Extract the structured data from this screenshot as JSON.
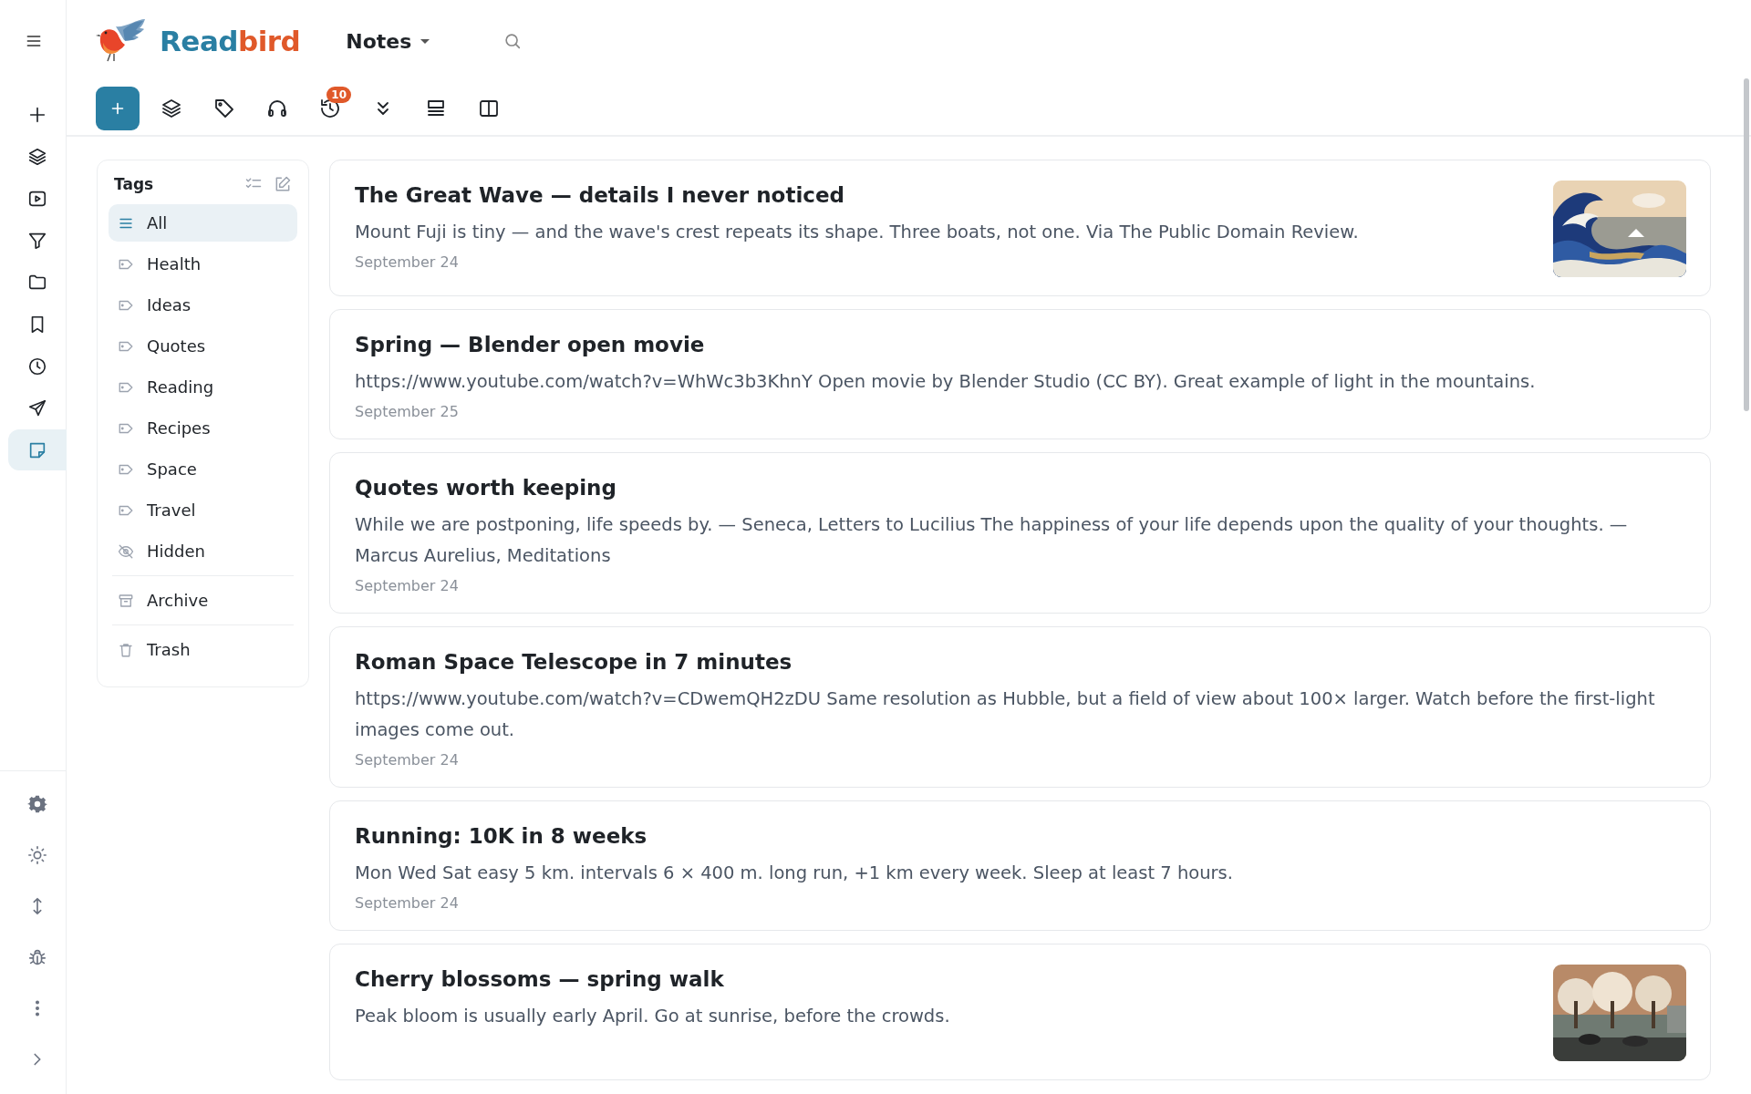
{
  "rail": {
    "top": [
      {
        "selected": false
      },
      {
        "selected": false
      },
      {
        "selected": false
      },
      {
        "selected": false
      },
      {
        "selected": false
      },
      {
        "selected": false
      },
      {
        "selected": false
      },
      {
        "selected": false
      },
      {
        "selected": true
      }
    ],
    "bottom": [
      {
        "selected": false
      },
      {
        "selected": false
      },
      {
        "selected": false
      },
      {
        "selected": false
      },
      {
        "selected": false
      },
      {
        "selected": false
      }
    ]
  },
  "header": {
    "brand": {
      "parts": [
        "Read",
        "bird"
      ]
    },
    "view_menu": {
      "label": "Notes"
    },
    "toolbar": {
      "history_badge": "10"
    }
  },
  "tags": {
    "title": "Tags",
    "items": [
      {
        "kind": "all",
        "label": "All",
        "selected": true
      },
      {
        "kind": "tag",
        "label": "Health",
        "selected": false
      },
      {
        "kind": "tag",
        "label": "Ideas",
        "selected": false
      },
      {
        "kind": "tag",
        "label": "Quotes",
        "selected": false
      },
      {
        "kind": "tag",
        "label": "Reading",
        "selected": false
      },
      {
        "kind": "tag",
        "label": "Recipes",
        "selected": false
      },
      {
        "kind": "tag",
        "label": "Space",
        "selected": false
      },
      {
        "kind": "tag",
        "label": "Travel",
        "selected": false
      },
      {
        "kind": "hidden",
        "label": "Hidden",
        "selected": false
      },
      {
        "kind": "archive",
        "label": "Archive",
        "selected": false
      },
      {
        "kind": "trash",
        "label": "Trash",
        "selected": false
      }
    ]
  },
  "notes": [
    {
      "title": "The Great Wave — details I never noticed",
      "body": "Mount Fuji is tiny — and the wave's crest repeats its shape. Three boats, not one.  Via The Public Domain Review.",
      "date": "September 24",
      "thumbnail": true
    },
    {
      "title": "Spring — Blender open movie",
      "body": "https://www.youtube.com/watch?v=WhWc3b3KhnY Open movie by Blender Studio (CC BY). Great example of light in the mountains.",
      "date": "September 25",
      "thumbnail": false
    },
    {
      "title": "Quotes worth keeping",
      "body": "While we are postponing, life speeds by. — Seneca, Letters to Lucilius The happiness of your life depends upon the quality of your thoughts. — Marcus Aurelius, Meditations",
      "date": "September 24",
      "thumbnail": false
    },
    {
      "title": "Roman Space Telescope in 7 minutes",
      "body": "https://www.youtube.com/watch?v=CDwemQH2zDU Same resolution as Hubble, but a field of view about 100× larger. Watch before the first-light images come out.",
      "date": "September 24",
      "thumbnail": false
    },
    {
      "title": "Running: 10K in 8 weeks",
      "body": "Mon  Wed  Sat  easy 5 km. intervals 6 × 400 m.  long run, +1 km every week. Sleep at least 7 hours.",
      "date": "September 24",
      "thumbnail": false
    },
    {
      "title": "Cherry blossoms — spring walk",
      "body": "Peak bloom is usually early April. Go at sunrise, before the crowds.",
      "thumbnail": true
    }
  ]
}
